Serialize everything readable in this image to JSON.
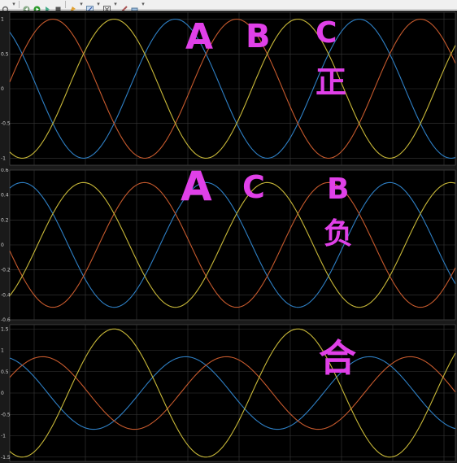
{
  "toolbar": {
    "icons": [
      "settings-icon",
      "step-back-icon",
      "run-icon",
      "step-forward-icon",
      "stop-icon",
      "highlight-icon",
      "zoom-icon",
      "autoscale-icon",
      "measure-icon",
      "brush-icon"
    ]
  },
  "colors": {
    "background": "#000000",
    "grid": "#3a3a3a",
    "series1": "#2e7fc4",
    "series2": "#c75a2d",
    "series3": "#c8b838",
    "annotation": "#e040e8"
  },
  "annotations": {
    "top": [
      "A",
      "B",
      "C",
      "正"
    ],
    "middle": [
      "A",
      "C",
      "B",
      "负"
    ],
    "bottom": [
      "合"
    ]
  },
  "chart_data": [
    {
      "type": "line",
      "title": "",
      "xlabel": "",
      "ylabel": "",
      "ylim": [
        -1.1,
        1.1
      ],
      "yticks": [
        "1",
        "0.5",
        "0",
        "-0.5",
        "-1"
      ],
      "grid": true,
      "series": [
        {
          "color": "#2e7fc4",
          "amplitude": 1.0,
          "phase_deg": 30
        },
        {
          "color": "#c75a2d",
          "amplitude": 1.0,
          "phase_deg": -90
        },
        {
          "color": "#c8b838",
          "amplitude": 1.0,
          "phase_deg": 150
        }
      ]
    },
    {
      "type": "line",
      "title": "",
      "xlabel": "",
      "ylabel": "",
      "ylim": [
        -0.6,
        0.6
      ],
      "yticks": [
        "0.6",
        "0.4",
        "0.2",
        "0",
        "-0.2",
        "-0.4",
        "-0.6"
      ],
      "grid": true,
      "series": [
        {
          "color": "#2e7fc4",
          "amplitude": 0.5,
          "phase_deg": -30
        },
        {
          "color": "#c75a2d",
          "amplitude": 0.5,
          "phase_deg": 90
        },
        {
          "color": "#c8b838",
          "amplitude": 0.5,
          "phase_deg": -150
        }
      ]
    },
    {
      "type": "line",
      "title": "",
      "xlabel": "",
      "ylabel": "",
      "ylim": [
        -1.6,
        1.6
      ],
      "yticks": [
        "1.5",
        "1",
        "0.5",
        "0",
        "-0.5",
        "-1",
        "-1.5"
      ],
      "grid": true,
      "series": [
        {
          "color": "#2e7fc4",
          "amplitude": 0.85,
          "phase_deg": 10
        },
        {
          "color": "#c75a2d",
          "amplitude": 0.85,
          "phase_deg": -70
        },
        {
          "color": "#c8b838",
          "amplitude": 1.5,
          "phase_deg": 150
        }
      ]
    }
  ]
}
